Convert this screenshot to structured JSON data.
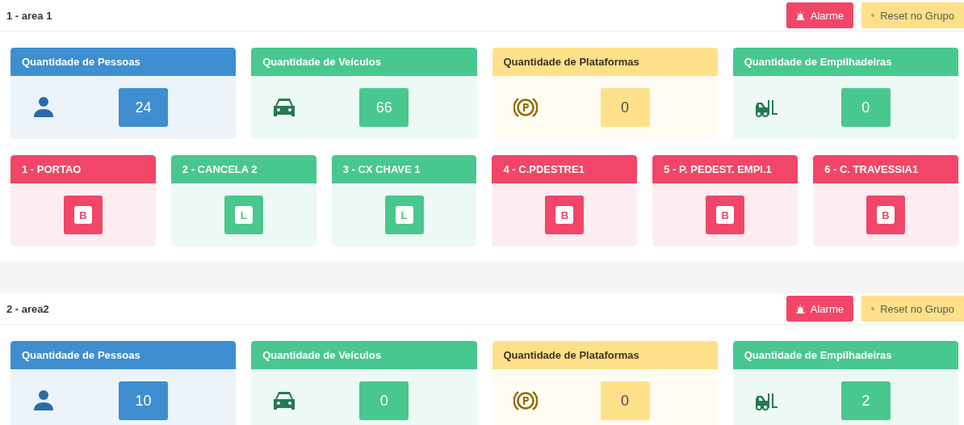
{
  "areas": [
    {
      "title": "1 - area 1",
      "buttons": [
        {
          "kind": "alarm",
          "label": "Alarme"
        },
        {
          "kind": "reset",
          "label": "Reset no Grupo"
        }
      ],
      "counters": [
        {
          "kind": "people",
          "title": "Quantidade de Pessoas",
          "value": "24",
          "color": "#3e8ed0"
        },
        {
          "kind": "vehicles",
          "title": "Quantidade de Veículos",
          "value": "66",
          "color": "#48c78e"
        },
        {
          "kind": "platforms",
          "title": "Quantidade de Plataformas",
          "value": "0",
          "color": "#ffe08a"
        },
        {
          "kind": "forklifts",
          "title": "Quantidade de Empilhadeiras",
          "value": "0",
          "color": "#48c78e"
        }
      ],
      "devices": [
        {
          "title": "1 - PORTAO",
          "status": "B",
          "color": "#f14668"
        },
        {
          "title": "2 - CANCELA 2",
          "status": "L",
          "color": "#48c78e"
        },
        {
          "title": "3 - CX CHAVE 1",
          "status": "L",
          "color": "#48c78e"
        },
        {
          "title": "4 - C.PDESTRE1",
          "status": "B",
          "color": "#f14668"
        },
        {
          "title": "5 - P. PEDEST. EMPI.1",
          "status": "B",
          "color": "#f14668"
        },
        {
          "title": "6 - C. TRAVESSIA1",
          "status": "B",
          "color": "#f14668"
        }
      ]
    },
    {
      "title": "2 - area2",
      "buttons": [
        {
          "kind": "alarm",
          "label": "Alarme"
        },
        {
          "kind": "reset",
          "label": "Reset no Grupo"
        }
      ],
      "counters": [
        {
          "kind": "people",
          "title": "Quantidade de Pessoas",
          "value": "10",
          "color": "#3e8ed0"
        },
        {
          "kind": "vehicles",
          "title": "Quantidade de Veículos",
          "value": "0",
          "color": "#48c78e"
        },
        {
          "kind": "platforms",
          "title": "Quantidade de Plataformas",
          "value": "0",
          "color": "#ffe08a"
        },
        {
          "kind": "forklifts",
          "title": "Quantidade de Empilhadeiras",
          "value": "2",
          "color": "#48c78e"
        }
      ]
    }
  ]
}
